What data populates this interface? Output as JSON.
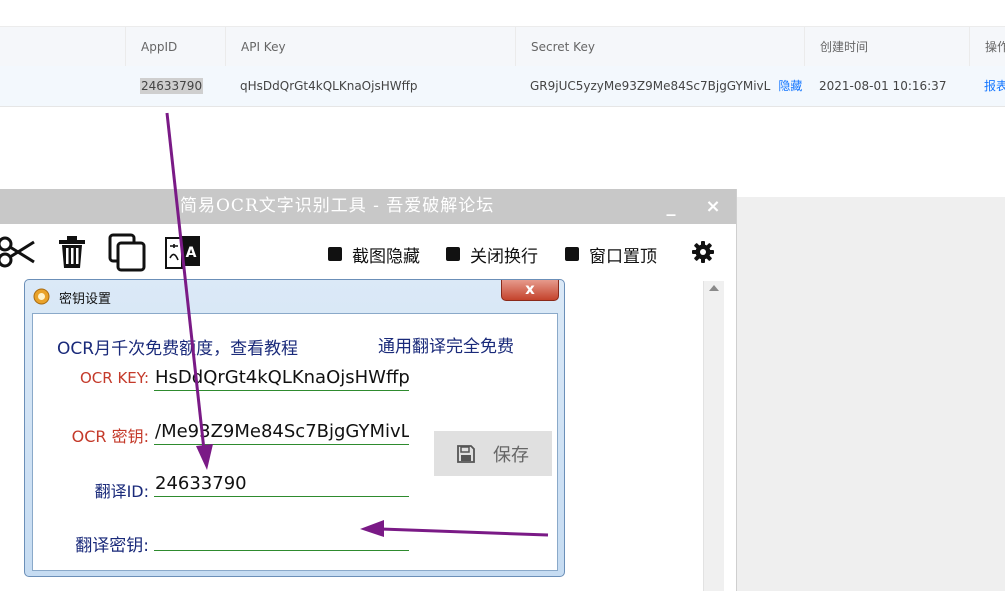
{
  "table": {
    "headers": [
      "AppID",
      "API Key",
      "Secret Key",
      "创建时间",
      "操作"
    ],
    "row": {
      "appid": "24633790",
      "api_key": "qHsDdQrGt4kQLKnaOjsHWffp",
      "secret_key": "GR9jUC5yzyMe93Z9Me84Sc7BjgGYMivL",
      "hide_link": "隐藏",
      "created": "2021-08-01 10:16:37",
      "action": "报表"
    }
  },
  "app": {
    "title": "简易OCR文字识别工具 - 吾爱破解论坛",
    "minimize": "_",
    "close": "×",
    "options": {
      "screenshot_hide": "截图隐藏",
      "close_wrap": "关闭换行",
      "window_top": "窗口置顶"
    }
  },
  "dialog": {
    "title": "密钥设置",
    "close": "x",
    "ocr_quota_link": "OCR月千次免费额度，查看教程",
    "translate_free_link": "通用翻译完全免费",
    "ocr_key_label": "OCR KEY:",
    "ocr_key_value": "HsDdQrGt4kQLKnaOjsHWffp",
    "ocr_secret_label": "OCR 密钥:",
    "ocr_secret_value": "/Me93Z9Me84Sc7BjgGYMivL",
    "translate_id_label": "翻译ID:",
    "translate_id_value": "24633790",
    "translate_secret_label": "翻译密钥:",
    "translate_secret_value": "",
    "save_label": "保存"
  },
  "colors": {
    "annotation_arrow": "#7a1a86",
    "field_underline": "#2e8b2e",
    "label_red": "#c43a2a",
    "label_blue": "#1a2a7a"
  }
}
